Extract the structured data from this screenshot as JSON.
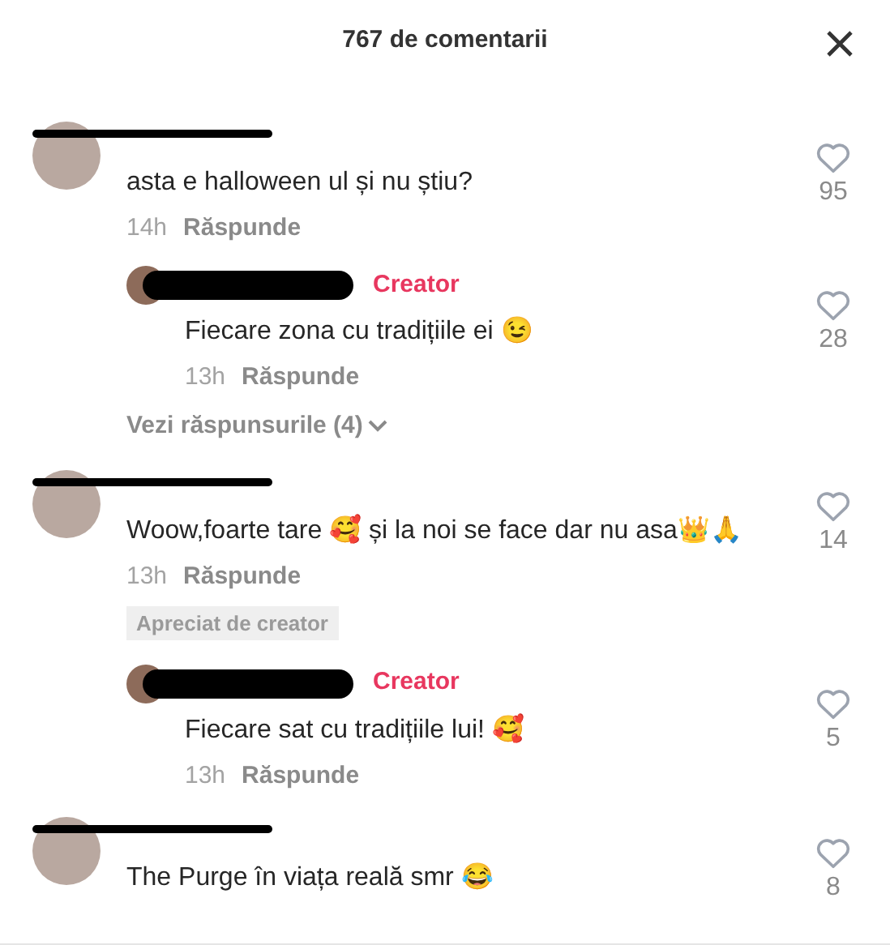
{
  "header": {
    "title": "767 de comentarii"
  },
  "comments": [
    {
      "kind": "comment",
      "text": "asta e halloween ul și nu știu?",
      "time": "14h",
      "reply_label": "Răspunde",
      "likes": "95"
    },
    {
      "kind": "reply",
      "badge": "Creator",
      "text": "Fiecare zona cu tradițiile ei 😉",
      "time": "13h",
      "reply_label": "Răspunde",
      "likes": "28"
    },
    {
      "kind": "more",
      "text": "Vezi răspunsurile (4)"
    },
    {
      "kind": "comment",
      "text": "Woow,foarte tare 🥰 și la noi se face dar nu asa👑🙏",
      "time": "13h",
      "reply_label": "Răspunde",
      "likes": "14",
      "tag": "Apreciat de creator"
    },
    {
      "kind": "reply",
      "badge": "Creator",
      "text": "Fiecare sat cu tradițiile lui! 🥰",
      "time": "13h",
      "reply_label": "Răspunde",
      "likes": "5"
    },
    {
      "kind": "comment",
      "text": "The Purge în viața reală smr 😂",
      "likes": "8"
    }
  ]
}
